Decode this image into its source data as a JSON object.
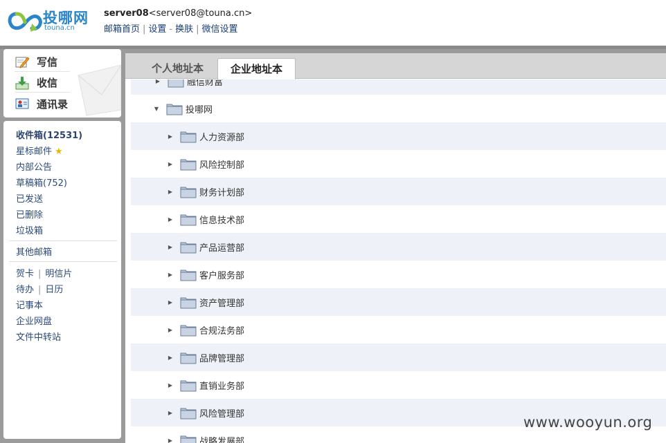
{
  "header": {
    "logo_text": "投哪网",
    "logo_sub": "touna.cn",
    "user_name": "server08",
    "user_email": "<server08@touna.cn>",
    "nav": [
      "邮箱首页",
      "设置",
      "换肤",
      "微信设置"
    ],
    "nav_seps": [
      "|",
      "-",
      "|"
    ]
  },
  "quick_actions": [
    {
      "label": "写信",
      "icon": "pencil-icon"
    },
    {
      "label": "收信",
      "icon": "inbox-download-icon"
    },
    {
      "label": "通讯录",
      "icon": "contacts-icon"
    }
  ],
  "folders": {
    "inbox": "收件箱(12531)",
    "starred": "星标邮件",
    "announcements": "内部公告",
    "drafts": "草稿箱(752)",
    "sent": "已发送",
    "deleted": "已删除",
    "spam": "垃圾箱",
    "other_mailboxes": "其他邮箱",
    "greeting_card": "贺卡",
    "postcard": "明信片",
    "todo": "待办",
    "calendar": "日历",
    "notes": "记事本",
    "netdisk": "企业网盘",
    "file_transfer": "文件中转站"
  },
  "tabs": {
    "personal": "个人地址本",
    "enterprise": "企业地址本",
    "active": "enterprise"
  },
  "tree": {
    "partial_top": "融信财富",
    "root": "投哪网",
    "departments": [
      "人力资源部",
      "风险控制部",
      "财务计划部",
      "信息技术部",
      "产品运营部",
      "客户服务部",
      "资产管理部",
      "合规法务部",
      "品牌管理部",
      "直销业务部",
      "风险管理部",
      "战略发展部"
    ]
  },
  "watermark": "www.wooyun.org",
  "colors": {
    "brand": "#2a86c9",
    "link": "#1a3f7a",
    "row_alt": "#eef2f8",
    "frame": "#9b9b9b"
  }
}
